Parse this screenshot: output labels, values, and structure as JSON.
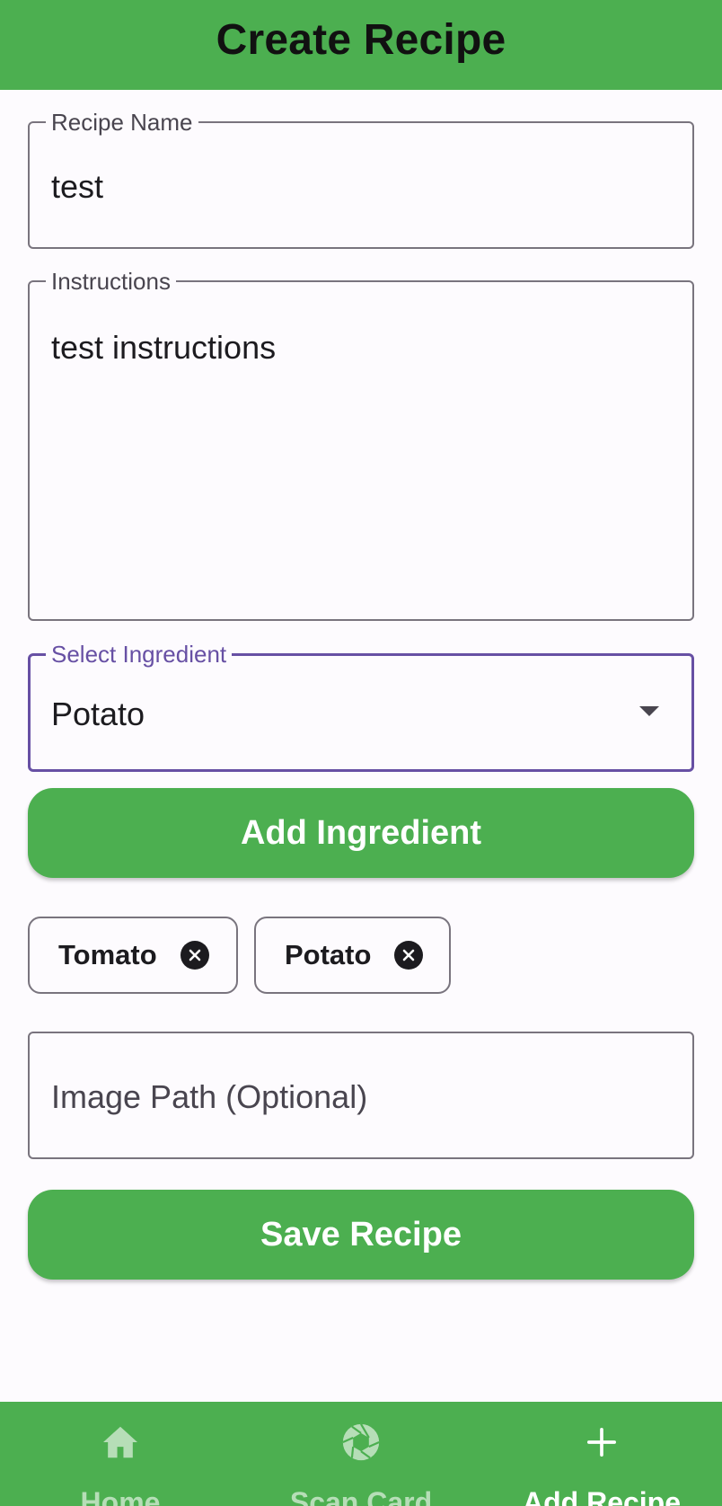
{
  "app_bar": {
    "title": "Create Recipe"
  },
  "form": {
    "recipe_name": {
      "label": "Recipe Name",
      "value": "test"
    },
    "instructions": {
      "label": "Instructions",
      "value": "test instructions"
    },
    "ingredient_select": {
      "label": "Select Ingredient",
      "value": "Potato"
    },
    "add_ingredient_button": "Add Ingredient",
    "selected_ingredients": [
      {
        "label": "Tomato"
      },
      {
        "label": "Potato"
      }
    ],
    "image_path": {
      "placeholder": "Image Path (Optional)",
      "value": ""
    },
    "save_button": "Save Recipe"
  },
  "bottom_nav": {
    "items": [
      {
        "label": "Home",
        "icon": "home-icon",
        "active": false
      },
      {
        "label": "Scan Card",
        "icon": "camera-shutter-icon",
        "active": false
      },
      {
        "label": "Add Recipe",
        "icon": "plus-icon",
        "active": true
      }
    ]
  },
  "colors": {
    "primary_green": "#4caf50",
    "focus_purple": "#6750a4",
    "outline": "#79747e",
    "inactive_nav": "#b6deb7"
  }
}
